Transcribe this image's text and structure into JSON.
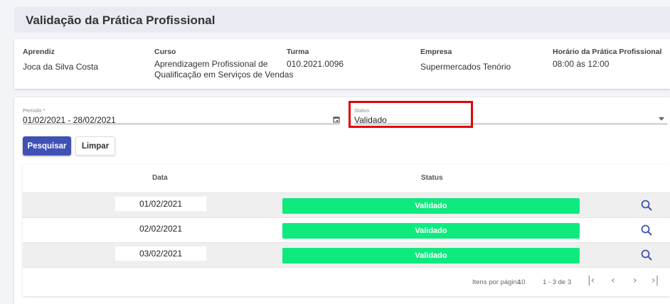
{
  "header": {
    "title": "Validação da Prática Profissional"
  },
  "info": {
    "aprendiz": {
      "label": "Aprendiz",
      "value": "Joca da Silva Costa"
    },
    "curso": {
      "label": "Curso",
      "value_line1": "Aprendizagem Profissional de",
      "value_line2": "Qualificação em Serviços de Vendas"
    },
    "turma": {
      "label": "Turma",
      "value": "010.2021.0096"
    },
    "empresa": {
      "label": "Empresa",
      "value": "Supermercados Tenório"
    },
    "horario": {
      "label": "Horário da Prática Profissional",
      "value": "08:00 às 12:00"
    }
  },
  "filters": {
    "periodo": {
      "label": "Período *",
      "value": "01/02/2021 - 28/02/2021"
    },
    "status": {
      "label": "Status",
      "value": "Validado"
    },
    "search_label": "Pesquisar",
    "clear_label": "Limpar"
  },
  "table": {
    "columns": {
      "data": "Data",
      "status": "Status"
    },
    "rows": [
      {
        "data": "01/02/2021",
        "status": "Validado"
      },
      {
        "data": "02/02/2021",
        "status": "Validado"
      },
      {
        "data": "03/02/2021",
        "status": "Validado"
      }
    ]
  },
  "pagination": {
    "per_page_label": "Itens por página",
    "per_page_value": "10",
    "range": "1 - 3 de 3"
  },
  "colors": {
    "primary": "#3f51b5",
    "status_valid": "#0fea7f",
    "highlight": "#e00000"
  }
}
